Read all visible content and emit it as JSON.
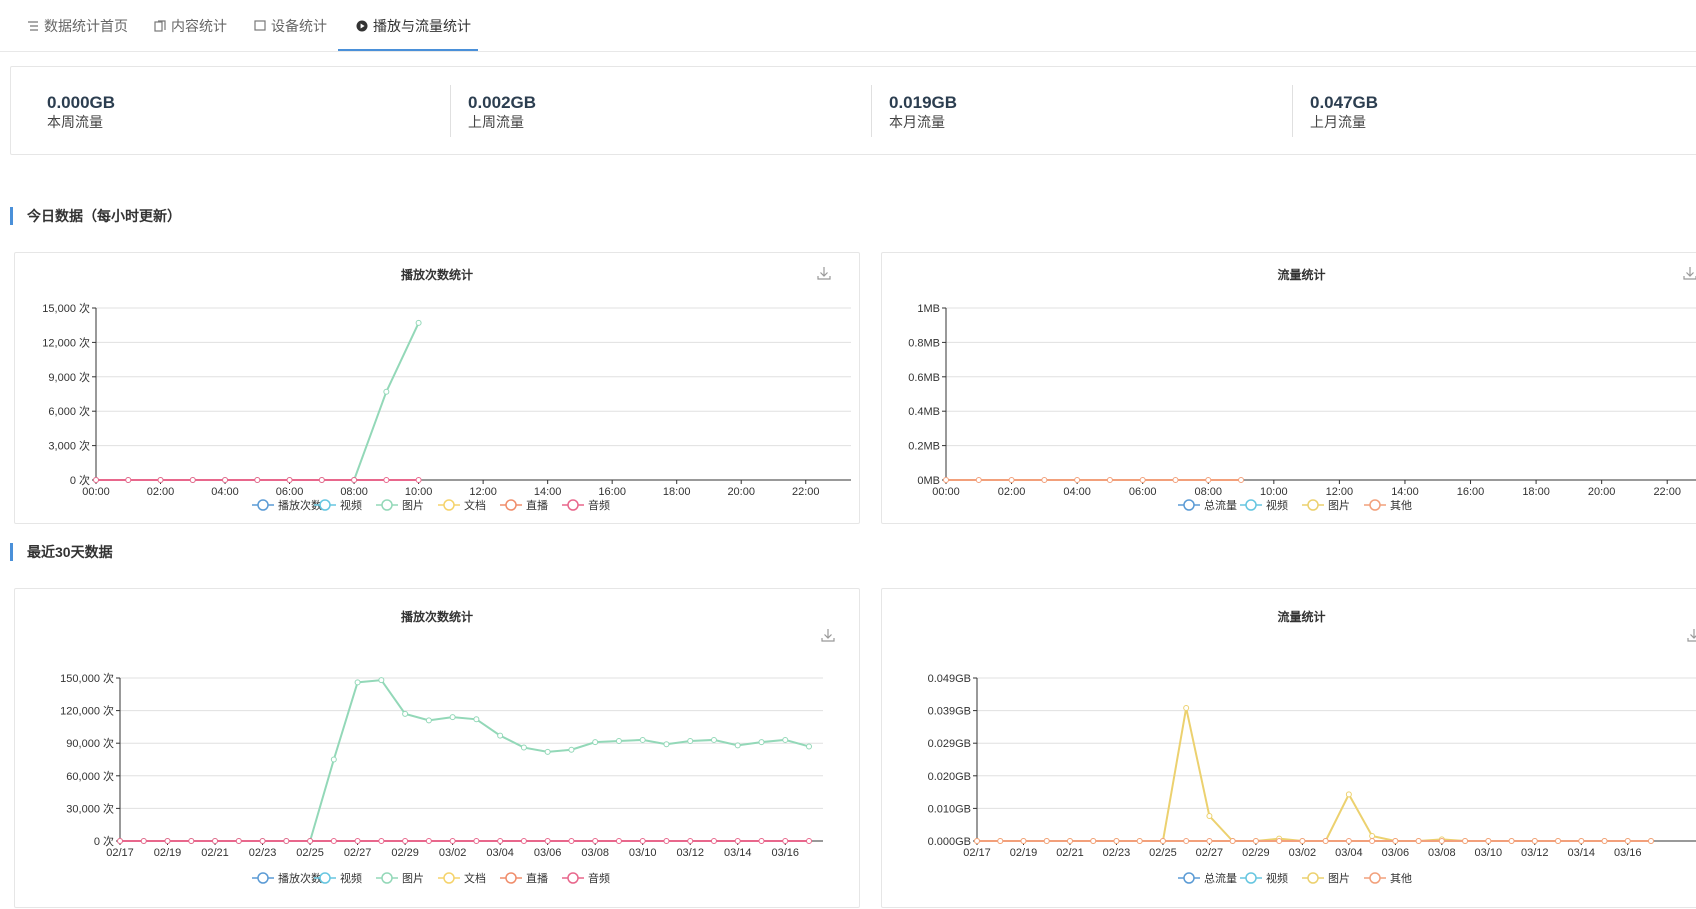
{
  "tabs": [
    {
      "label": "数据统计首页",
      "icon": "list-icon"
    },
    {
      "label": "内容统计",
      "icon": "files-icon"
    },
    {
      "label": "设备统计",
      "icon": "monitor-icon"
    },
    {
      "label": "播放与流量统计",
      "icon": "play-circle-icon",
      "active": true
    }
  ],
  "summary": [
    {
      "value": "0.000GB",
      "label": "本周流量"
    },
    {
      "value": "0.002GB",
      "label": "上周流量"
    },
    {
      "value": "0.019GB",
      "label": "本月流量"
    },
    {
      "value": "0.047GB",
      "label": "上月流量"
    }
  ],
  "sections": {
    "today": "今日数据（每小时更新）",
    "last30": "最近30天数据"
  },
  "colors": {
    "accent": "#4a90d9",
    "播放次数": "#5b9bd5",
    "视频": "#66c6e0",
    "图片_play": "#93d8b8",
    "文档": "#f5d36b",
    "直播": "#f08d6b",
    "音频": "#e8678c",
    "总流量": "#5b9bd5",
    "图片_flow": "#ecd16f",
    "其他": "#f2a07b"
  },
  "chart_data": [
    {
      "title": "播放次数统计",
      "type": "line",
      "x": [
        "00:00",
        "01:00",
        "02:00",
        "03:00",
        "04:00",
        "05:00",
        "06:00",
        "07:00",
        "08:00",
        "09:00",
        "10:00"
      ],
      "x_ticks": [
        "00:00",
        "02:00",
        "04:00",
        "06:00",
        "08:00",
        "10:00",
        "12:00",
        "14:00",
        "16:00",
        "18:00",
        "20:00",
        "22:00"
      ],
      "y_ticks": [
        "0 次",
        "3,000 次",
        "6,000 次",
        "9,000 次",
        "12,000 次",
        "15,000 次"
      ],
      "ylim": [
        0,
        15000
      ],
      "legend": [
        "播放次数",
        "视频",
        "图片",
        "文档",
        "直播",
        "音频"
      ],
      "series": [
        {
          "name": "图片",
          "values": [
            0,
            0,
            0,
            0,
            0,
            0,
            0,
            0,
            0,
            7700,
            13700
          ]
        },
        {
          "name": "音频",
          "values": [
            0,
            0,
            0,
            0,
            0,
            0,
            0,
            0,
            0,
            0,
            0
          ]
        }
      ]
    },
    {
      "title": "流量统计",
      "type": "line",
      "x": [
        "00:00",
        "01:00",
        "02:00",
        "03:00",
        "04:00",
        "05:00",
        "06:00",
        "07:00",
        "08:00",
        "09:00"
      ],
      "x_ticks": [
        "00:00",
        "02:00",
        "04:00",
        "06:00",
        "08:00",
        "10:00",
        "12:00",
        "14:00",
        "16:00",
        "18:00",
        "20:00",
        "22:00"
      ],
      "y_ticks": [
        "0MB",
        "0.2MB",
        "0.4MB",
        "0.6MB",
        "0.8MB",
        "1MB"
      ],
      "ylim": [
        0,
        1
      ],
      "legend": [
        "总流量",
        "视频",
        "图片",
        "其他"
      ],
      "series": [
        {
          "name": "其他",
          "values": [
            0,
            0,
            0,
            0,
            0,
            0,
            0,
            0,
            0,
            0
          ]
        }
      ]
    },
    {
      "title": "播放次数统计",
      "type": "line",
      "x": [
        "02/17",
        "02/18",
        "02/19",
        "02/20",
        "02/21",
        "02/22",
        "02/23",
        "02/24",
        "02/25",
        "02/26",
        "02/27",
        "02/28",
        "02/29",
        "03/01",
        "03/02",
        "03/03",
        "03/04",
        "03/05",
        "03/06",
        "03/07",
        "03/08",
        "03/09",
        "03/10",
        "03/11",
        "03/12",
        "03/13",
        "03/14",
        "03/15",
        "03/16",
        "03/17"
      ],
      "x_ticks": [
        "02/17",
        "02/19",
        "02/21",
        "02/23",
        "02/25",
        "02/27",
        "02/29",
        "03/02",
        "03/04",
        "03/06",
        "03/08",
        "03/10",
        "03/12",
        "03/14",
        "03/16"
      ],
      "y_ticks": [
        "0 次",
        "30,000 次",
        "60,000 次",
        "90,000 次",
        "120,000 次",
        "150,000 次"
      ],
      "ylim": [
        0,
        150000
      ],
      "legend": [
        "播放次数",
        "视频",
        "图片",
        "文档",
        "直播",
        "音频"
      ],
      "series": [
        {
          "name": "图片",
          "values": [
            0,
            0,
            0,
            0,
            0,
            0,
            0,
            0,
            0,
            75000,
            146000,
            148000,
            117000,
            111000,
            114000,
            112000,
            97000,
            86000,
            82000,
            84000,
            91000,
            92000,
            93000,
            89000,
            92000,
            93000,
            88000,
            91000,
            93000,
            87000
          ]
        },
        {
          "name": "音频",
          "values": [
            0,
            0,
            0,
            0,
            0,
            0,
            0,
            0,
            0,
            0,
            0,
            0,
            0,
            0,
            0,
            0,
            0,
            0,
            0,
            0,
            0,
            0,
            0,
            0,
            0,
            0,
            0,
            0,
            0,
            0
          ]
        }
      ]
    },
    {
      "title": "流量统计",
      "type": "line",
      "x": [
        "02/17",
        "02/18",
        "02/19",
        "02/20",
        "02/21",
        "02/22",
        "02/23",
        "02/24",
        "02/25",
        "02/26",
        "02/27",
        "02/28",
        "02/29",
        "03/01",
        "03/02",
        "03/03",
        "03/04",
        "03/05",
        "03/06",
        "03/07",
        "03/08",
        "03/09",
        "03/10",
        "03/11",
        "03/12",
        "03/13",
        "03/14",
        "03/15",
        "03/16",
        "03/17"
      ],
      "x_ticks": [
        "02/17",
        "02/19",
        "02/21",
        "02/23",
        "02/25",
        "02/27",
        "02/29",
        "03/02",
        "03/04",
        "03/06",
        "03/08",
        "03/10",
        "03/12",
        "03/14",
        "03/16"
      ],
      "y_ticks": [
        "0.000GB",
        "0.010GB",
        "0.020GB",
        "0.029GB",
        "0.039GB",
        "0.049GB"
      ],
      "ylim": [
        0,
        0.049
      ],
      "legend": [
        "总流量",
        "视频",
        "图片",
        "其他"
      ],
      "series": [
        {
          "name": "图片",
          "values": [
            0,
            0,
            0,
            0,
            0,
            0,
            0,
            0,
            0,
            0.04,
            0.0075,
            0,
            0,
            0.0007,
            0,
            0,
            0.014,
            0.0015,
            0,
            0,
            0.0005,
            0,
            0,
            0,
            0,
            0,
            0,
            0,
            0,
            0
          ]
        },
        {
          "name": "其他",
          "values": [
            0,
            0,
            0,
            0,
            0,
            0,
            0,
            0,
            0,
            0,
            0,
            0,
            0,
            0,
            0,
            0,
            0,
            0,
            0,
            0,
            0,
            0,
            0,
            0,
            0,
            0,
            0,
            0,
            0,
            0
          ]
        }
      ]
    }
  ]
}
